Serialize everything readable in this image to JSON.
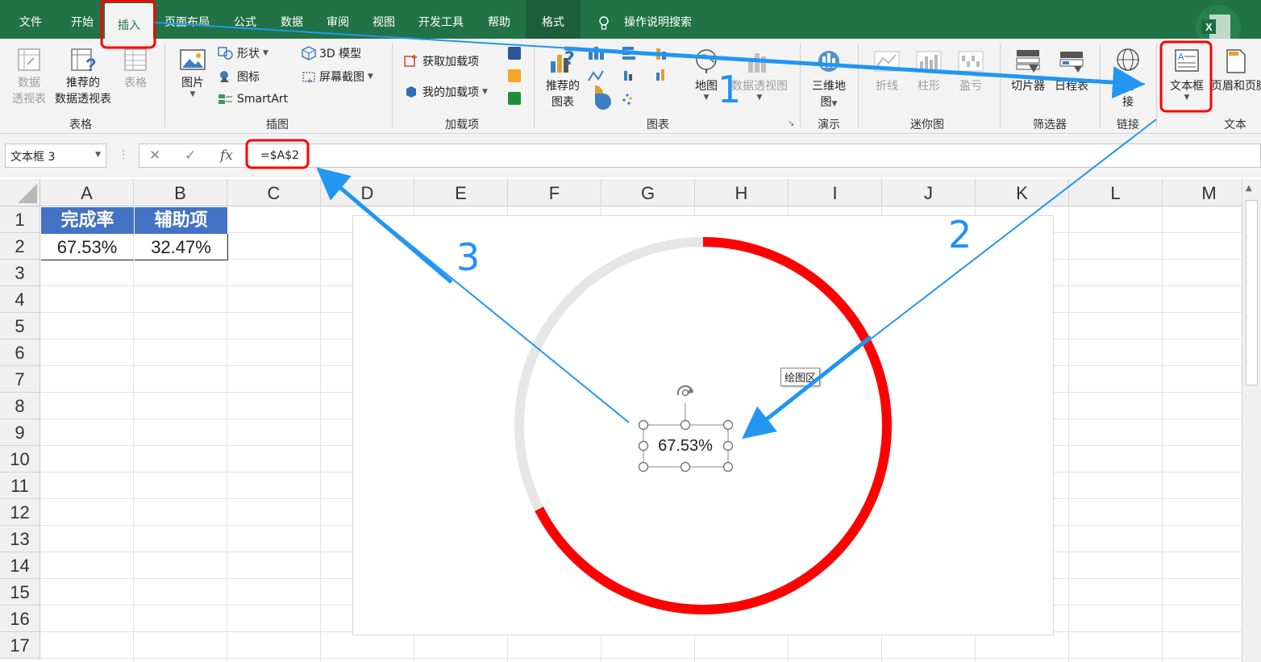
{
  "tabs": [
    {
      "label": "文件"
    },
    {
      "label": "开始"
    },
    {
      "label": "插入"
    },
    {
      "label": "页面布局"
    },
    {
      "label": "公式"
    },
    {
      "label": "数据"
    },
    {
      "label": "审阅"
    },
    {
      "label": "视图"
    },
    {
      "label": "开发工具"
    },
    {
      "label": "帮助"
    },
    {
      "label": "格式"
    },
    {
      "label": "操作说明搜索"
    }
  ],
  "ribbon": {
    "tables": {
      "pivot": "数据\n透视表",
      "pivot_l1": "数据",
      "pivot_l2": "透视表",
      "rec_l1": "推荐的",
      "rec_l2": "数据透视表",
      "table": "表格",
      "group": "表格"
    },
    "illustrations": {
      "picture": "图片",
      "shapes": "形状",
      "icons": "图标",
      "smartart": "SmartArt",
      "model3d": "3D 模型",
      "screenshot": "屏幕截图",
      "group": "插图"
    },
    "addins": {
      "get": "获取加载项",
      "my": "我的加载项",
      "group": "加载项"
    },
    "charts": {
      "rec_l1": "推荐的",
      "rec_l2": "图表",
      "map": "地图",
      "pivotchart": "数据透视图",
      "group": "图表"
    },
    "tours": {
      "map3d_l1": "三维地",
      "map3d_l2": "图",
      "group": "演示"
    },
    "sparklines": {
      "line": "折线",
      "column": "柱形",
      "winloss": "盈亏",
      "group": "迷你图"
    },
    "filters": {
      "slicer": "切片器",
      "timeline": "日程表",
      "group": "筛选器"
    },
    "links": {
      "link_l1": "链",
      "link_l2": "接",
      "group": "链接"
    },
    "text": {
      "textbox": "文本框",
      "headerfooter": "页眉和页脚",
      "group": "文本"
    }
  },
  "formula_bar": {
    "name_box": "文本框 3",
    "formula": "=$A$2",
    "fx": "fx"
  },
  "columns": [
    "A",
    "B",
    "C",
    "D",
    "E",
    "F",
    "G",
    "H",
    "I",
    "J",
    "K",
    "L",
    "M"
  ],
  "rows": [
    "1",
    "2",
    "3",
    "4",
    "5",
    "6",
    "7",
    "8",
    "9",
    "10",
    "11",
    "12",
    "13",
    "14",
    "15",
    "16",
    "17"
  ],
  "cells": {
    "A1": "完成率",
    "B1": "辅助项",
    "A2": "67.53%",
    "B2": "32.47%"
  },
  "chart": {
    "tooltip": "绘图区",
    "textbox_value": "67.53%",
    "completion": 0.6753,
    "remainder": 0.3247,
    "colors": {
      "completion": "#ff0000",
      "remainder": "#e6e6e6"
    }
  },
  "annotations": {
    "step1": "1",
    "step2": "2",
    "step3": "3",
    "arrow_color": "#2196f3",
    "highlight_color": "#ff0000"
  },
  "accent": "#217346"
}
